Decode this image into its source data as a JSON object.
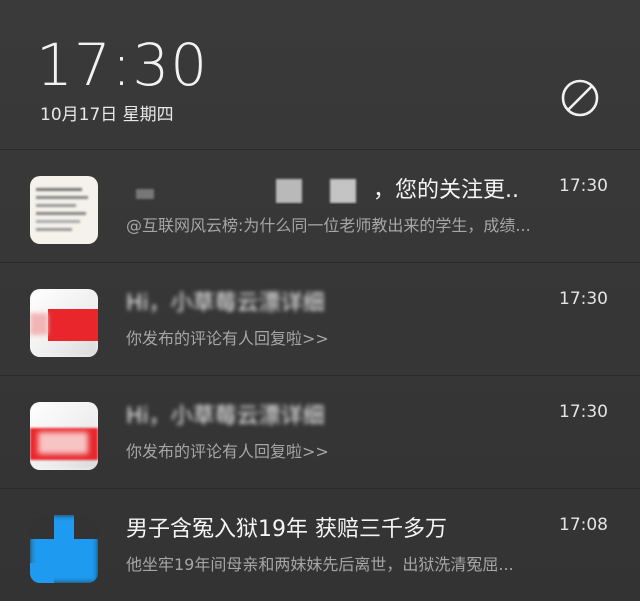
{
  "status": {
    "time": "17:30",
    "date": "10月17日 星期四"
  },
  "icons": {
    "dnd": "do-not-disturb-icon"
  },
  "notifications": [
    {
      "title": "，您的关注更..",
      "time": "17:30",
      "text": "@互联网风云榜:为什么同一位老师教出来的学生，成绩...",
      "icon": "news-app-icon"
    },
    {
      "title": "Hi，小草莓云漂详细",
      "time": "17:30",
      "text": "你发布的评论有人回复啦>>",
      "icon": "video-app-icon"
    },
    {
      "title": "Hi，小草莓云漂详细",
      "time": "17:30",
      "text": "你发布的评论有人回复啦>>",
      "icon": "video-app-icon"
    },
    {
      "title": "男子含冤入狱19年 获赔三千多万",
      "time": "17:08",
      "text": "他坐牢19年间母亲和两妹妹先后离世，出狱洗清冤屈...",
      "icon": "news-app-icon"
    }
  ],
  "colors": {
    "background": "#363636",
    "divider": "#2a2a2a",
    "accent_red": "#e8262b",
    "accent_blue": "#1e9bf0"
  }
}
